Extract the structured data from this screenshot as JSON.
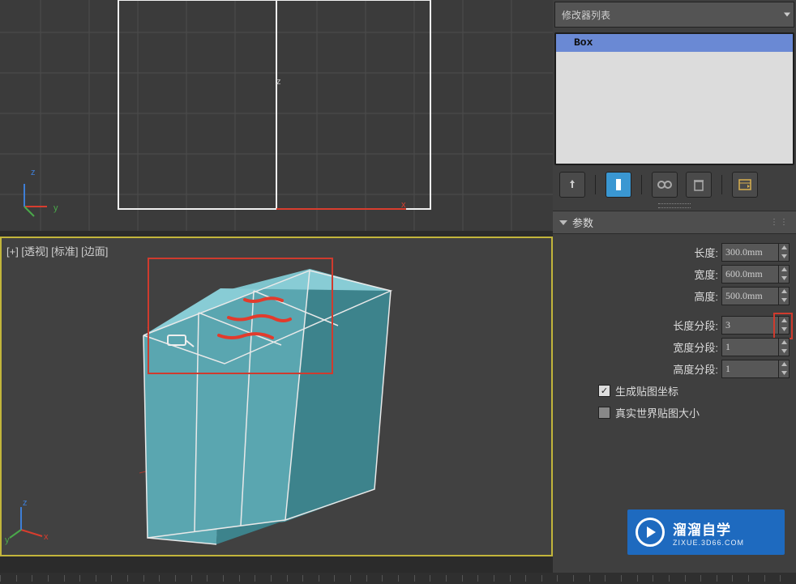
{
  "modifier_list_label": "修改器列表",
  "modifier_stack": {
    "items": [
      "Box"
    ]
  },
  "toolbar": {
    "pin": "pin",
    "show_end_result": "show-end-result",
    "make_unique": "make-unique",
    "remove": "remove",
    "configure": "configure"
  },
  "rollout": {
    "title": "参数",
    "length_label": "长度:",
    "length_value": "300.0mm",
    "width_label": "宽度:",
    "width_value": "600.0mm",
    "height_label": "高度:",
    "height_value": "500.0mm",
    "length_segs_label": "长度分段:",
    "length_segs_value": "3",
    "width_segs_label": "宽度分段:",
    "width_segs_value": "1",
    "height_segs_label": "高度分段:",
    "height_segs_value": "1",
    "gen_mapping_label": "生成贴图坐标",
    "gen_mapping_checked": true,
    "real_world_label": "真实世界贴图大小",
    "real_world_checked": false
  },
  "viewport_bottom": {
    "label": "[+] [透视] [标准] [边面]",
    "axis_z": "z",
    "axis_x": "x",
    "axis_y": "y"
  },
  "viewport_top": {
    "axis_z": "z",
    "axis_x": "x",
    "axis_y": "y"
  },
  "watermark": {
    "title": "溜溜自学",
    "sub": "ZIXUE.3D66.COM"
  }
}
